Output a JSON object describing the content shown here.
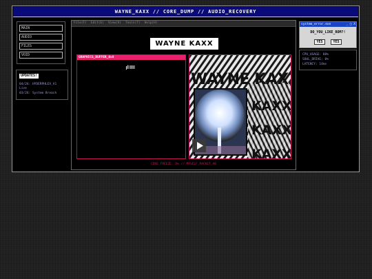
{
  "window": {
    "title": "WAYNE_KAXX // CORE_DUMP // AUDIO_RECOVERY"
  },
  "sidebar": {
    "items": [
      {
        "label": "MAIN"
      },
      {
        "label": "AUDIO"
      },
      {
        "label": "FILES"
      },
      {
        "label": "VOID"
      }
    ]
  },
  "updates": {
    "title": "UPDATES!",
    "lines": [
      "04/26: HYDERPHLEX_V1",
      "Live",
      "03/26: System Breach"
    ]
  },
  "center": {
    "menu": [
      "File(F)",
      "Edit(E)",
      "View(V)",
      "Tools(T)",
      "Help(H)"
    ],
    "logo": "WAYNE KAXX",
    "gfx_title": "GRAPHICS_BUFFER_0x0",
    "gfx_mini": "▌▒▒▒",
    "video_text": [
      "WAYNE KAXX",
      "KAXX",
      "KAXX",
      "KAXX"
    ],
    "status": "CORE_FREEZE: 0% // MYSELF_PACKET_AB"
  },
  "dialog": {
    "title": "system_error.exe",
    "window_controls": "_ □ X",
    "question": "DO_YOU_LIKE_ROM?!",
    "yes1": "YES",
    "yes2": "YES"
  },
  "stats": {
    "lines": [
      "CPU_USAGE: 88%",
      "SOUL_DRIVE: 0%",
      "LATENCY: 14ms"
    ]
  },
  "colors": {
    "title_bar": "#0a0a78",
    "accent": "#e8206e",
    "dialog_title": "#1a44c8"
  }
}
